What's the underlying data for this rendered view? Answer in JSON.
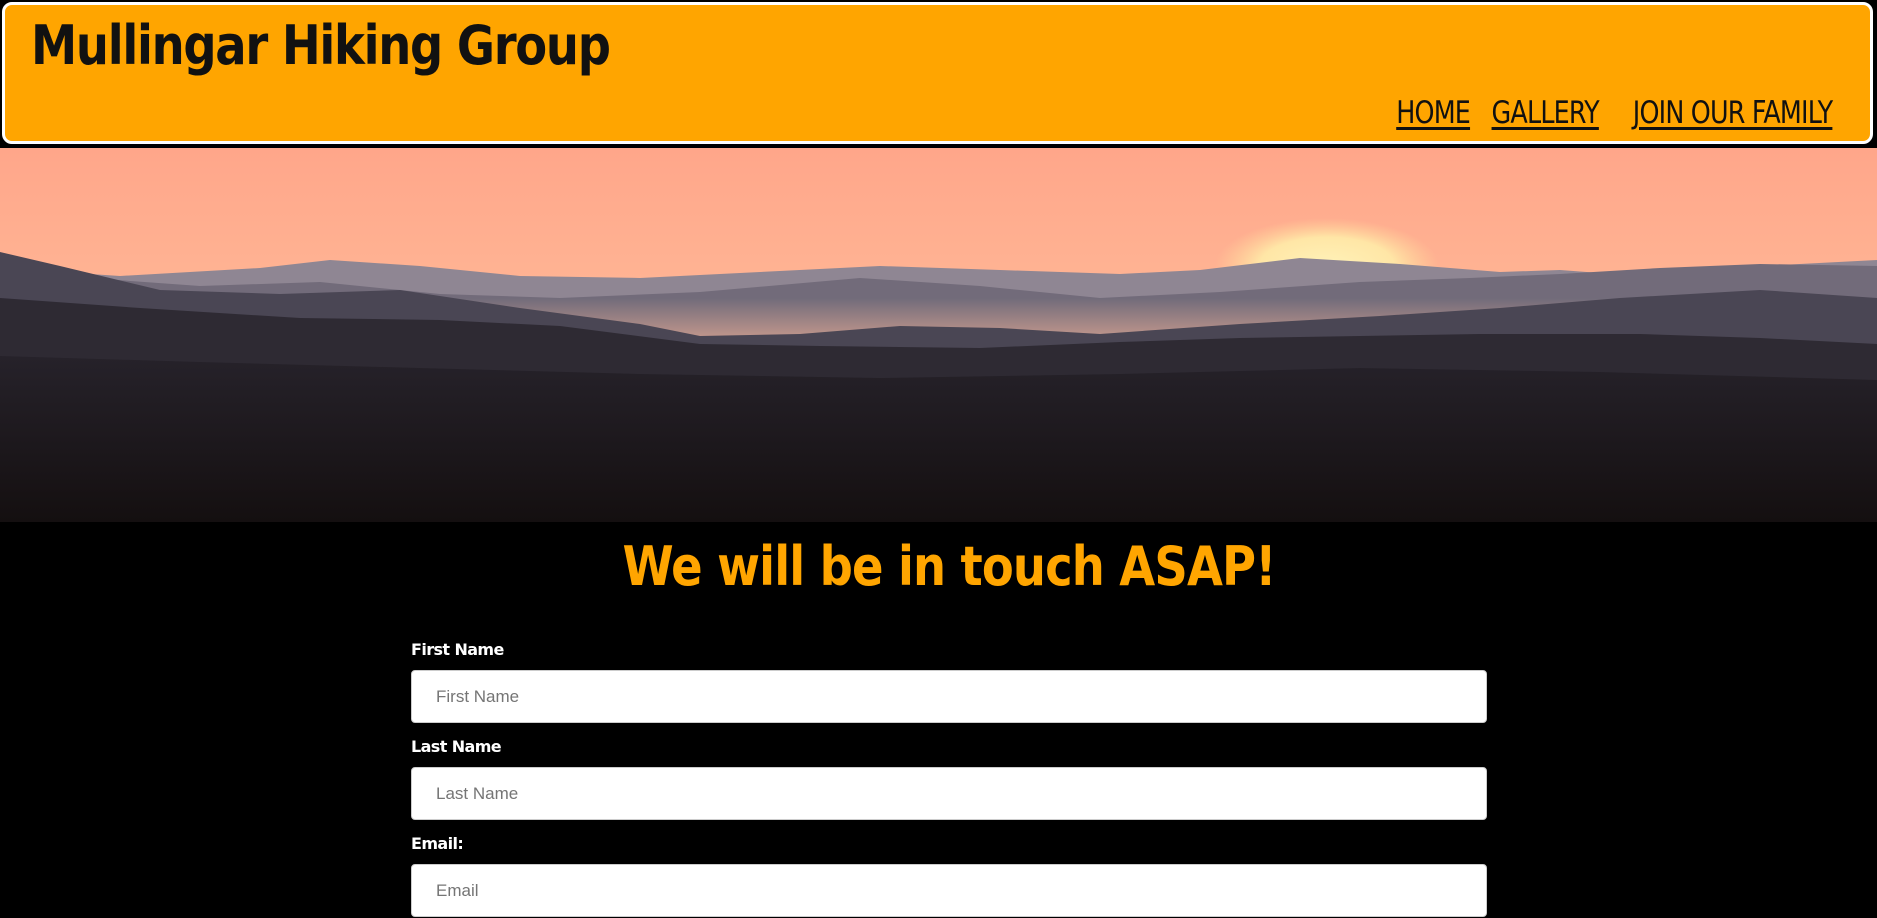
{
  "header": {
    "title": "Mullingar Hiking Group",
    "nav": [
      {
        "label": "HOME"
      },
      {
        "label": "GALLERY"
      },
      {
        "label": "JOIN OUR FAMILY"
      }
    ]
  },
  "hero": {
    "icon": "mountain-sunset-image"
  },
  "form": {
    "heading": "We will be in touch ASAP!",
    "fields": [
      {
        "label": "First Name",
        "placeholder": "First Name"
      },
      {
        "label": "Last Name",
        "placeholder": "Last Name"
      },
      {
        "label": "Email:",
        "placeholder": "Email"
      }
    ]
  },
  "colors": {
    "accent": "#ffa500",
    "header_text": "#111111",
    "background": "#000000",
    "label": "#ffffff"
  }
}
